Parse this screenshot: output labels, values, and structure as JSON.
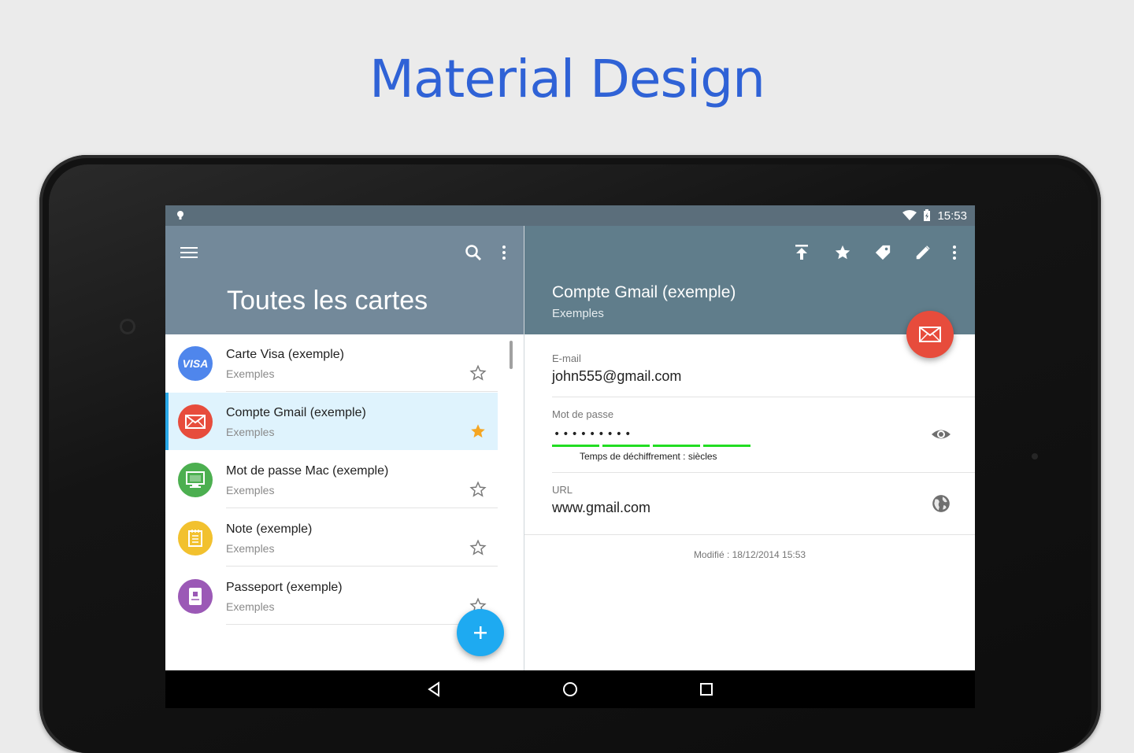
{
  "headline": "Material Design",
  "statusbar": {
    "time": "15:53"
  },
  "list_panel": {
    "title": "Toutes les cartes",
    "items": [
      {
        "title": "Carte Visa (exemple)",
        "subtitle": "Exemples",
        "icon": "visa-icon",
        "color": "#4f86ec",
        "favorite": false,
        "badge": "VISA"
      },
      {
        "title": "Compte Gmail (exemple)",
        "subtitle": "Exemples",
        "icon": "mail-icon",
        "color": "#e74c3c",
        "favorite": true
      },
      {
        "title": "Mot de passe Mac (exemple)",
        "subtitle": "Exemples",
        "icon": "monitor-icon",
        "color": "#4caf50",
        "favorite": false
      },
      {
        "title": "Note (exemple)",
        "subtitle": "Exemples",
        "icon": "note-icon",
        "color": "#f2c12e",
        "favorite": false
      },
      {
        "title": "Passeport (exemple)",
        "subtitle": "Exemples",
        "icon": "passport-icon",
        "color": "#9b59b6",
        "favorite": false
      }
    ]
  },
  "detail_panel": {
    "title": "Compte Gmail (exemple)",
    "subtitle": "Exemples",
    "email_label": "E-mail",
    "email_value": "john555@gmail.com",
    "password_label": "Mot de passe",
    "password_mask": "•••••••••",
    "password_strength": 1.0,
    "strength_text": "Temps de déchiffrement : siècles",
    "url_label": "URL",
    "url_value": "www.gmail.com",
    "modified": "Modifié : 18/12/2014 15:53"
  },
  "colors": {
    "accent_blue": "#1eaaf1",
    "header_left": "#73899a",
    "header_right": "#607d8b",
    "favorite_star": "#f5a623",
    "headline": "#2f62d6"
  }
}
